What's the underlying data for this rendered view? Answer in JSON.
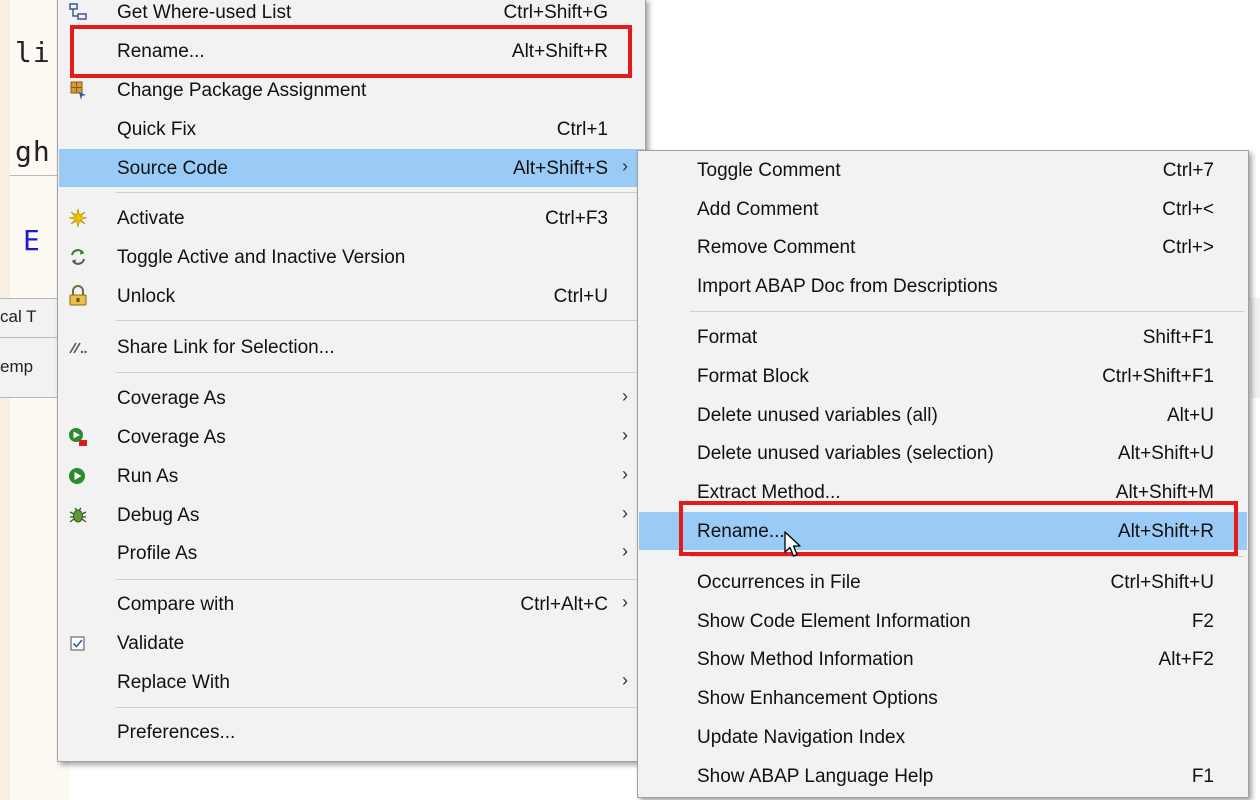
{
  "editor": {
    "fragments": [
      "li",
      "gh",
      "E"
    ],
    "tab_fragments": [
      "cal T",
      "emp"
    ]
  },
  "colors": {
    "menu_bg": "#f2f2f2",
    "highlight": "#99cbf6",
    "red_box": "#e31b1b",
    "keyword_blue": "#1b17d4"
  },
  "main_menu": {
    "items": [
      {
        "label": "Get Where-used List",
        "shortcut": "Ctrl+Shift+G",
        "icon": "where-used-icon"
      },
      {
        "label": "Rename...",
        "shortcut": "Alt+Shift+R",
        "icon": ""
      },
      {
        "label": "Change Package Assignment",
        "shortcut": "",
        "icon": "package-icon"
      },
      {
        "label": "Quick Fix",
        "shortcut": "Ctrl+1",
        "icon": ""
      },
      {
        "label": "Source Code",
        "shortcut": "Alt+Shift+S",
        "arrow": "›",
        "icon": ""
      },
      {
        "label": "Activate",
        "shortcut": "Ctrl+F3",
        "icon": "activate-icon"
      },
      {
        "label": "Toggle Active and Inactive Version",
        "shortcut": "",
        "icon": "toggle-version-icon"
      },
      {
        "label": "Unlock",
        "shortcut": "Ctrl+U",
        "icon": "lock-icon"
      },
      {
        "label": "Share Link for Selection...",
        "shortcut": "",
        "icon": "share-link-icon"
      },
      {
        "label": "Coverage As",
        "shortcut": "",
        "arrow": "›",
        "icon": ""
      },
      {
        "label": "Coverage As",
        "shortcut": "",
        "arrow": "›",
        "icon": "coverage-icon"
      },
      {
        "label": "Run As",
        "shortcut": "",
        "arrow": "›",
        "icon": "run-icon"
      },
      {
        "label": "Debug As",
        "shortcut": "",
        "arrow": "›",
        "icon": "debug-icon"
      },
      {
        "label": "Profile As",
        "shortcut": "",
        "arrow": "›",
        "icon": ""
      },
      {
        "label": "Compare with",
        "shortcut": "Ctrl+Alt+C",
        "arrow": "›",
        "icon": ""
      },
      {
        "label": "Validate",
        "shortcut": "",
        "icon": "checkbox-icon"
      },
      {
        "label": "Replace With",
        "shortcut": "",
        "arrow": "›",
        "icon": ""
      },
      {
        "label": "Preferences...",
        "shortcut": "",
        "icon": ""
      }
    ]
  },
  "source_code_submenu": {
    "items": [
      {
        "label": "Toggle Comment",
        "shortcut": "Ctrl+7"
      },
      {
        "label": "Add Comment",
        "shortcut": "Ctrl+<"
      },
      {
        "label": "Remove Comment",
        "shortcut": "Ctrl+>"
      },
      {
        "label": "Import ABAP Doc from Descriptions",
        "shortcut": ""
      },
      {
        "label": "Format",
        "shortcut": "Shift+F1"
      },
      {
        "label": "Format Block",
        "shortcut": "Ctrl+Shift+F1"
      },
      {
        "label": "Delete unused variables (all)",
        "shortcut": "Alt+U"
      },
      {
        "label": "Delete unused variables (selection)",
        "shortcut": "Alt+Shift+U"
      },
      {
        "label": "Extract Method...",
        "shortcut": "Alt+Shift+M"
      },
      {
        "label": "Rename...",
        "shortcut": "Alt+Shift+R"
      },
      {
        "label": "Occurrences in File",
        "shortcut": "Ctrl+Shift+U"
      },
      {
        "label": "Show Code Element Information",
        "shortcut": "F2"
      },
      {
        "label": "Show Method Information",
        "shortcut": "Alt+F2"
      },
      {
        "label": "Show Enhancement Options",
        "shortcut": ""
      },
      {
        "label": "Update Navigation Index",
        "shortcut": ""
      },
      {
        "label": "Show ABAP Language Help",
        "shortcut": "F1"
      }
    ]
  }
}
